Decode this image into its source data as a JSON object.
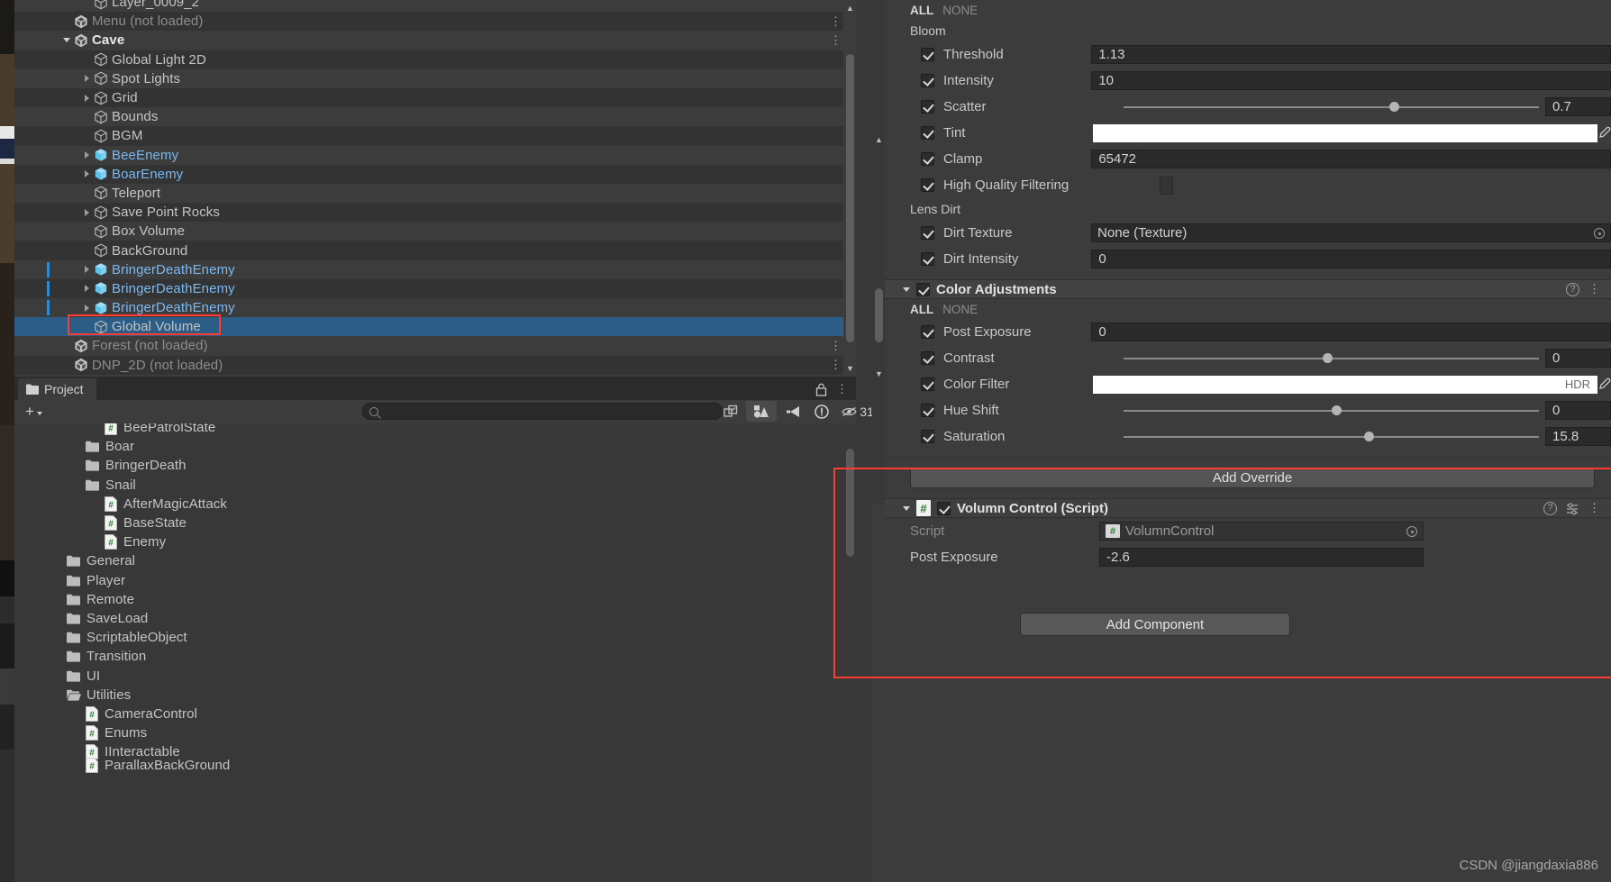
{
  "hierarchy": {
    "rows": [
      {
        "label": "Layer_0009_2",
        "indent": 88,
        "icon": "cube-outline-icon",
        "tri": "none",
        "style": "normal",
        "partial": true
      },
      {
        "label": "Menu (not loaded)",
        "indent": 66,
        "icon": "unity-scene-icon",
        "tri": "none",
        "style": "dim",
        "kebab": true
      },
      {
        "label": "Cave",
        "indent": 66,
        "icon": "unity-scene-icon",
        "tri": "open",
        "style": "bold",
        "kebab": true
      },
      {
        "label": "Global Light 2D",
        "indent": 88,
        "icon": "cube-outline-icon",
        "tri": "none",
        "style": "normal"
      },
      {
        "label": "Spot Lights",
        "indent": 88,
        "icon": "cube-outline-icon",
        "tri": "closed",
        "style": "normal"
      },
      {
        "label": "Grid",
        "indent": 88,
        "icon": "cube-outline-icon",
        "tri": "closed",
        "style": "normal"
      },
      {
        "label": "Bounds",
        "indent": 88,
        "icon": "cube-outline-icon",
        "tri": "none",
        "style": "normal"
      },
      {
        "label": "BGM",
        "indent": 88,
        "icon": "cube-outline-icon",
        "tri": "none",
        "style": "normal"
      },
      {
        "label": "BeeEnemy",
        "indent": 88,
        "icon": "prefab-cube-icon",
        "tri": "closed",
        "style": "prefab",
        "chevron": true
      },
      {
        "label": "BoarEnemy",
        "indent": 88,
        "icon": "prefab-cube-icon",
        "tri": "closed",
        "style": "prefab",
        "chevron": true
      },
      {
        "label": "Teleport",
        "indent": 88,
        "icon": "cube-outline-icon",
        "tri": "none",
        "style": "normal"
      },
      {
        "label": "Save Point Rocks",
        "indent": 88,
        "icon": "cube-outline-icon",
        "tri": "closed",
        "style": "normal"
      },
      {
        "label": "Box Volume",
        "indent": 88,
        "icon": "cube-outline-icon",
        "tri": "none",
        "style": "normal"
      },
      {
        "label": "BackGround",
        "indent": 88,
        "icon": "cube-outline-icon",
        "tri": "none",
        "style": "normal"
      },
      {
        "label": "BringerDeathEnemy",
        "indent": 88,
        "icon": "prefab-cube-icon",
        "tri": "closed",
        "style": "prefab",
        "chevron": true,
        "modified": true
      },
      {
        "label": "BringerDeathEnemy",
        "indent": 88,
        "icon": "prefab-cube-icon",
        "tri": "closed",
        "style": "prefab",
        "chevron": true,
        "modified": true
      },
      {
        "label": "BringerDeathEnemy",
        "indent": 88,
        "icon": "prefab-cube-icon",
        "tri": "closed",
        "style": "prefab",
        "chevron": true,
        "modified": true
      },
      {
        "label": "Global Volume",
        "indent": 88,
        "icon": "cube-outline-icon",
        "tri": "none",
        "style": "selected",
        "selected": true
      },
      {
        "label": "Forest (not loaded)",
        "indent": 66,
        "icon": "unity-scene-icon",
        "tri": "none",
        "style": "dim",
        "kebab": true
      },
      {
        "label": "DNP_2D (not loaded)",
        "indent": 66,
        "icon": "unity-scene-icon",
        "tri": "none",
        "style": "dim",
        "kebab": true
      }
    ]
  },
  "project": {
    "tab_label": "Project",
    "tab_icon": "folder-icon",
    "create_label": "+",
    "search_placeholder": "",
    "search_value": "",
    "toolbar_icons": [
      "open-in-new-icon",
      "shapes-filter-icon",
      "label-filter-icon",
      "warning-filter-icon"
    ],
    "hidden_count": "31",
    "hidden_count_icon": "eye-off-icon",
    "lock_icon": "lock-icon",
    "panel_menu_icon": "kebab-icon",
    "rows": [
      {
        "label": "BeePatrolState",
        "indent": 113,
        "type": "script",
        "tri": "none",
        "partial": true
      },
      {
        "label": "Boar",
        "indent": 92,
        "type": "folder",
        "tri": "closed"
      },
      {
        "label": "BringerDeath",
        "indent": 92,
        "type": "folder",
        "tri": "closed"
      },
      {
        "label": "Snail",
        "indent": 92,
        "type": "folder",
        "tri": "closed"
      },
      {
        "label": "AfterMagicAttack",
        "indent": 113,
        "type": "script",
        "tri": "none"
      },
      {
        "label": "BaseState",
        "indent": 113,
        "type": "script",
        "tri": "none"
      },
      {
        "label": "Enemy",
        "indent": 113,
        "type": "script",
        "tri": "none"
      },
      {
        "label": "General",
        "indent": 71,
        "type": "folder",
        "tri": "closed"
      },
      {
        "label": "Player",
        "indent": 71,
        "type": "folder",
        "tri": "closed"
      },
      {
        "label": "Remote",
        "indent": 71,
        "type": "folder",
        "tri": "closed"
      },
      {
        "label": "SaveLoad",
        "indent": 71,
        "type": "folder",
        "tri": "closed"
      },
      {
        "label": "ScriptableObject",
        "indent": 71,
        "type": "folder",
        "tri": "closed"
      },
      {
        "label": "Transition",
        "indent": 71,
        "type": "folder",
        "tri": "closed"
      },
      {
        "label": "UI",
        "indent": 71,
        "type": "folder",
        "tri": "closed"
      },
      {
        "label": "Utilities",
        "indent": 71,
        "type": "folder-open",
        "tri": "open"
      },
      {
        "label": "CameraControl",
        "indent": 92,
        "type": "script",
        "tri": "none"
      },
      {
        "label": "Enums",
        "indent": 92,
        "type": "script",
        "tri": "none"
      },
      {
        "label": "IInteractable",
        "indent": 92,
        "type": "script",
        "tri": "none"
      },
      {
        "label": "ParallaxBackGround",
        "indent": 92,
        "type": "script",
        "tri": "none",
        "partial": true
      }
    ]
  },
  "inspector": {
    "bloom": {
      "all_label": "ALL",
      "none_label": "NONE",
      "section_label": "Bloom",
      "rows": [
        {
          "label": "Threshold",
          "checked": true,
          "kind": "text",
          "value": "1.13"
        },
        {
          "label": "Intensity",
          "checked": true,
          "kind": "text",
          "value": "10"
        },
        {
          "label": "Scatter",
          "checked": true,
          "kind": "slider",
          "value": "0.7",
          "knob_pct": 64
        },
        {
          "label": "Tint",
          "checked": true,
          "kind": "color",
          "value": "",
          "color": "#ffffff"
        },
        {
          "label": "Clamp",
          "checked": true,
          "kind": "text",
          "value": "65472"
        },
        {
          "label": "High Quality Filtering",
          "checked": true,
          "kind": "checkbox",
          "value": ""
        }
      ],
      "lens_dirt_label": "Lens Dirt",
      "lens_rows": [
        {
          "label": "Dirt Texture",
          "checked": true,
          "kind": "object",
          "value": "None (Texture)"
        },
        {
          "label": "Dirt Intensity",
          "checked": true,
          "kind": "text",
          "value": "0"
        }
      ]
    },
    "color_adjustments": {
      "title": "Color Adjustments",
      "checked": true,
      "all_label": "ALL",
      "none_label": "NONE",
      "help_icon": "help-icon",
      "menu_icon": "kebab-icon",
      "rows": [
        {
          "label": "Post Exposure",
          "checked": true,
          "kind": "text",
          "value": "0"
        },
        {
          "label": "Contrast",
          "checked": true,
          "kind": "slider",
          "value": "0",
          "knob_pct": 48
        },
        {
          "label": "Color Filter",
          "checked": true,
          "kind": "color",
          "value": "HDR",
          "color": "#ffffff"
        },
        {
          "label": "Hue Shift",
          "checked": true,
          "kind": "slider",
          "value": "0",
          "knob_pct": 50
        },
        {
          "label": "Saturation",
          "checked": true,
          "kind": "slider",
          "value": "15.8",
          "knob_pct": 58
        }
      ]
    },
    "add_override_label": "Add Override",
    "script_component": {
      "title": "Volumn Control (Script)",
      "checked": true,
      "script_icon": "cs-script-icon",
      "help_icon": "help-icon",
      "preset_icon": "preset-icon",
      "menu_icon": "kebab-icon",
      "fields": [
        {
          "label": "Script",
          "value": "VolumnControl",
          "kind": "object",
          "disabled": true
        },
        {
          "label": "Post Exposure",
          "value": "-2.6",
          "kind": "text"
        }
      ]
    },
    "add_component_label": "Add Component"
  },
  "watermark": "CSDN @jiangdaxia886",
  "colors": {
    "selection_blue": "#2c5d87",
    "prefab_blue": "#79b8f3",
    "highlight_red": "#ff3b30",
    "panel_bg": "#3c3c3c"
  }
}
